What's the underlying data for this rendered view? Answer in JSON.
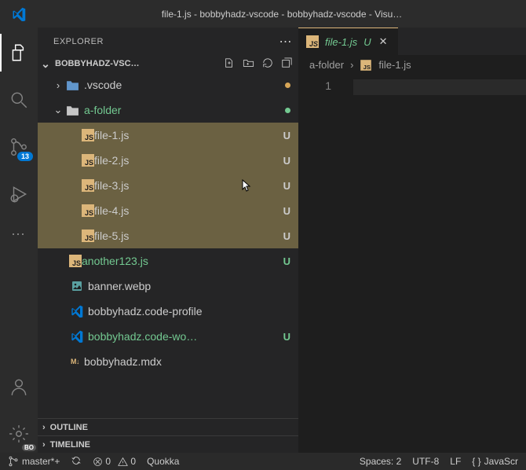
{
  "title": "file-1.js - bobbyhadz-vscode - bobbyhadz-vscode - Visu…",
  "activity": {
    "badge": "13",
    "bo": "BO"
  },
  "explorer": {
    "title": "EXPLORER",
    "workspace": "BOBBYHADZ-VSC…",
    "tree": [
      {
        "indent": 0,
        "tw": "›",
        "kind": "vscfold",
        "name": ".vscode",
        "dot": "amber"
      },
      {
        "indent": 0,
        "tw": "⌄",
        "kind": "folder",
        "name": "a-folder",
        "green": true,
        "dot": "green"
      },
      {
        "indent": 1,
        "kind": "js",
        "name": "file-1.js",
        "stat": "U",
        "sel": true
      },
      {
        "indent": 1,
        "kind": "js",
        "name": "file-2.js",
        "stat": "U",
        "sel": true
      },
      {
        "indent": 1,
        "kind": "js",
        "name": "file-3.js",
        "stat": "U",
        "sel": true,
        "cursor": true
      },
      {
        "indent": 1,
        "kind": "js",
        "name": "file-4.js",
        "stat": "U",
        "sel": true
      },
      {
        "indent": 1,
        "kind": "js",
        "name": "file-5.js",
        "stat": "U",
        "sel": true
      },
      {
        "indent": 0,
        "kind": "js",
        "name": "another123.js",
        "stat": "U",
        "green": true
      },
      {
        "indent": 0,
        "kind": "img",
        "name": "banner.webp"
      },
      {
        "indent": 0,
        "kind": "vsc",
        "name": "bobbyhadz.code-profile"
      },
      {
        "indent": 0,
        "kind": "vsc",
        "name": "bobbyhadz.code-wo…",
        "stat": "U",
        "green": true
      },
      {
        "indent": 0,
        "kind": "mdx",
        "name": "bobbyhadz.mdx"
      }
    ],
    "outline": "OUTLINE",
    "timeline": "TIMELINE"
  },
  "tab": {
    "name": "file-1.js",
    "stat": "U"
  },
  "crumbs": {
    "folder": "a-folder",
    "file": "file-1.js"
  },
  "gutter": {
    "line": "1"
  },
  "status": {
    "branch": "master*+",
    "errors": "0",
    "warnings": "0",
    "quokka": "Quokka",
    "spaces": "Spaces: 2",
    "enc": "UTF-8",
    "eol": "LF",
    "lang": "JavaScr"
  }
}
